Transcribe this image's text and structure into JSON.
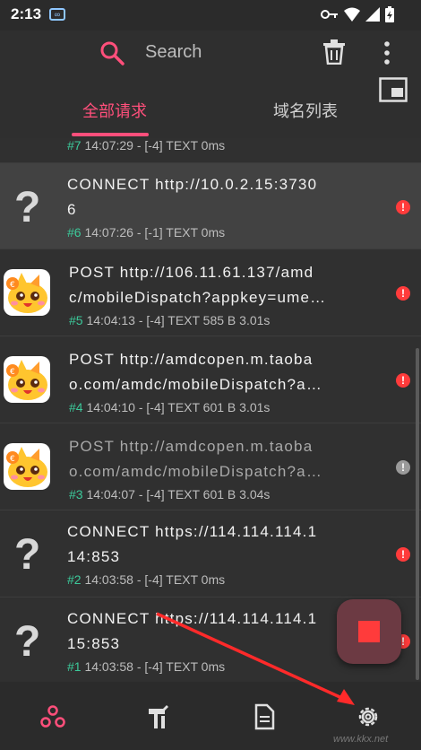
{
  "status": {
    "time": "2:13",
    "infinity": "∞"
  },
  "header": {
    "search_placeholder": "Search"
  },
  "tabs": [
    {
      "label": "全部请求"
    },
    {
      "label": "域名列表"
    }
  ],
  "requests": [
    {
      "line1": "",
      "line2": "",
      "meta_num": "#7",
      "meta": " 14:07:29 - [-4] TEXT  0ms"
    },
    {
      "line1": "CONNECT http://10.0.2.15:3730",
      "line2": "6",
      "meta_num": "#6",
      "meta": " 14:07:26 - [-1] TEXT  0ms",
      "status": "!"
    },
    {
      "line1": "POST http://106.11.61.137/amd",
      "line2": "c/mobileDispatch?appkey=ume…",
      "meta_num": "#5",
      "meta": " 14:04:13 - [-4] TEXT 585 B 3.01s",
      "status": "!"
    },
    {
      "line1": "POST http://amdcopen.m.taoba",
      "line2": "o.com/amdc/mobileDispatch?a…",
      "meta_num": "#4",
      "meta": " 14:04:10 - [-4] TEXT 601 B 3.01s",
      "status": "!"
    },
    {
      "line1": "POST http://amdcopen.m.taoba",
      "line2": "o.com/amdc/mobileDispatch?a…",
      "meta_num": "#3",
      "meta": " 14:04:07 - [-4] TEXT 601 B 3.04s",
      "status": "!"
    },
    {
      "line1": "CONNECT https://114.114.114.1",
      "line2": "14:853",
      "meta_num": "#2",
      "meta": " 14:03:58 - [-4] TEXT  0ms",
      "status": "!"
    },
    {
      "line1": "CONNECT https://114.114.114.1",
      "line2": "15:853",
      "meta_num": "#1",
      "meta": " 14:03:58 - [-4] TEXT  0ms",
      "status": "!"
    }
  ],
  "unknown_icon": "?",
  "watermark": "www.kkx.net",
  "colors": {
    "accent": "#ff4f7b",
    "error": "#ff3b3b",
    "id_green": "#3cc99a"
  }
}
